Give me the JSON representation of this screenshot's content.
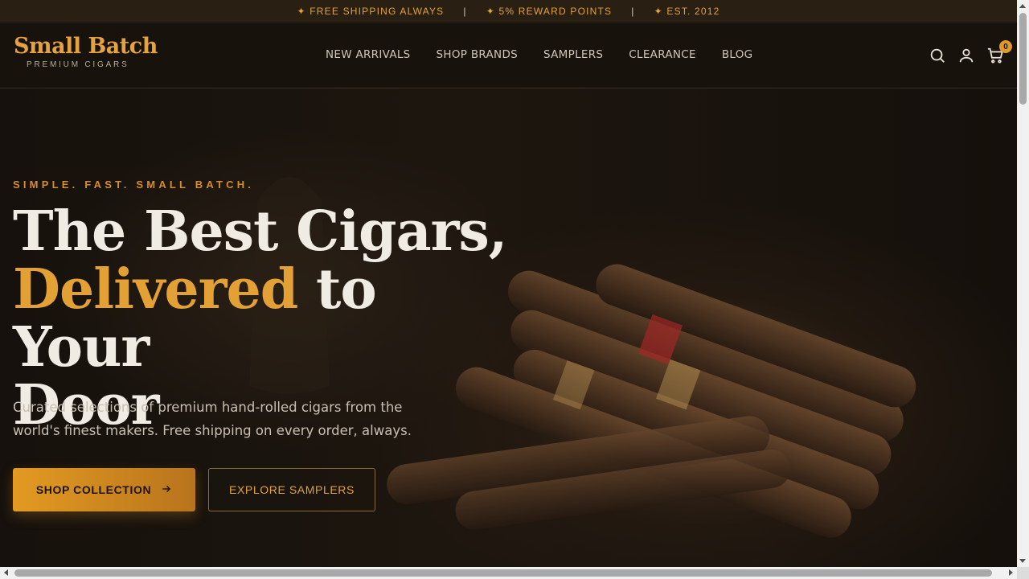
{
  "announcement": {
    "items": [
      "✦ FREE SHIPPING ALWAYS",
      "✦ 5% REWARD POINTS",
      "✦ EST. 2012"
    ],
    "separator": "|"
  },
  "brand": {
    "name": "Small Batch",
    "tagline": "PREMIUM CIGARS"
  },
  "nav": {
    "items": [
      "NEW ARRIVALS",
      "SHOP BRANDS",
      "SAMPLERS",
      "CLEARANCE",
      "BLOG"
    ]
  },
  "header_icons": {
    "search": "search-icon",
    "account": "user-icon",
    "cart": "cart-icon",
    "cart_count": "0"
  },
  "hero": {
    "eyebrow": "SIMPLE. FAST. SMALL BATCH.",
    "headline_line1": "The Best Cigars,",
    "headline_accent": "Delivered",
    "headline_line2_rest": " to Your",
    "headline_line3": "Door",
    "description": "Curated selections of premium hand-rolled cigars from the world's finest makers. Free shipping on every order, always.",
    "primary_cta": "SHOP COLLECTION",
    "primary_cta_icon": "arrow-right-icon",
    "secondary_cta": "EXPLORE SAMPLERS"
  },
  "colors": {
    "accent": "#e3a035",
    "background": "#16110c",
    "topbar": "#2a1f13"
  }
}
